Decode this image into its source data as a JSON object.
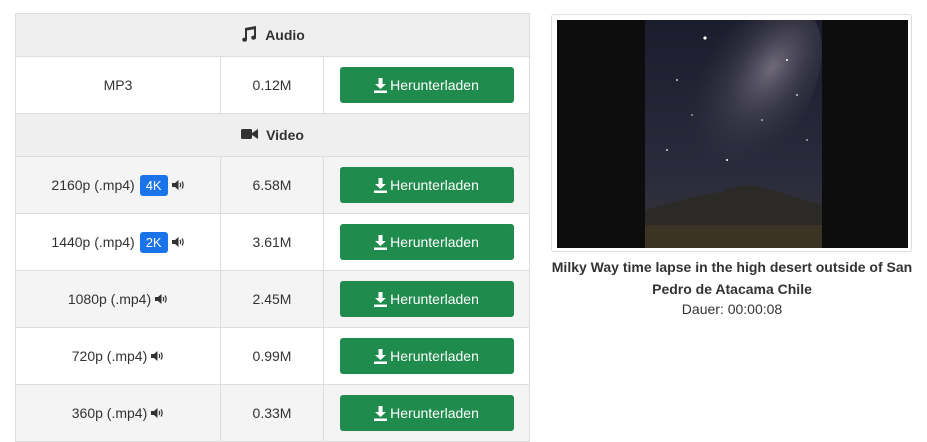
{
  "audio_section": {
    "title": "Audio",
    "icon": "music-note-icon"
  },
  "video_section": {
    "title": "Video",
    "icon": "video-camera-icon"
  },
  "download_label": "Herunterladen",
  "colors": {
    "button": "#1f8b4c",
    "badge": "#1a73e8",
    "section_bg": "#efefef"
  },
  "audio_formats": [
    {
      "format": "MP3",
      "size": "0.12M"
    }
  ],
  "video_formats": [
    {
      "format": "2160p (.mp4)",
      "badge": "4K",
      "size": "6.58M",
      "has_audio": true
    },
    {
      "format": "1440p (.mp4)",
      "badge": "2K",
      "size": "3.61M",
      "has_audio": true
    },
    {
      "format": "1080p (.mp4)",
      "size": "2.45M",
      "has_audio": true
    },
    {
      "format": "720p (.mp4)",
      "size": "0.99M",
      "has_audio": true
    },
    {
      "format": "360p (.mp4)",
      "size": "0.33M",
      "has_audio": true
    }
  ],
  "video": {
    "title": "Milky Way time lapse in the high desert outside of San Pedro de Atacama Chile",
    "duration": "Dauer: 00:00:08"
  }
}
